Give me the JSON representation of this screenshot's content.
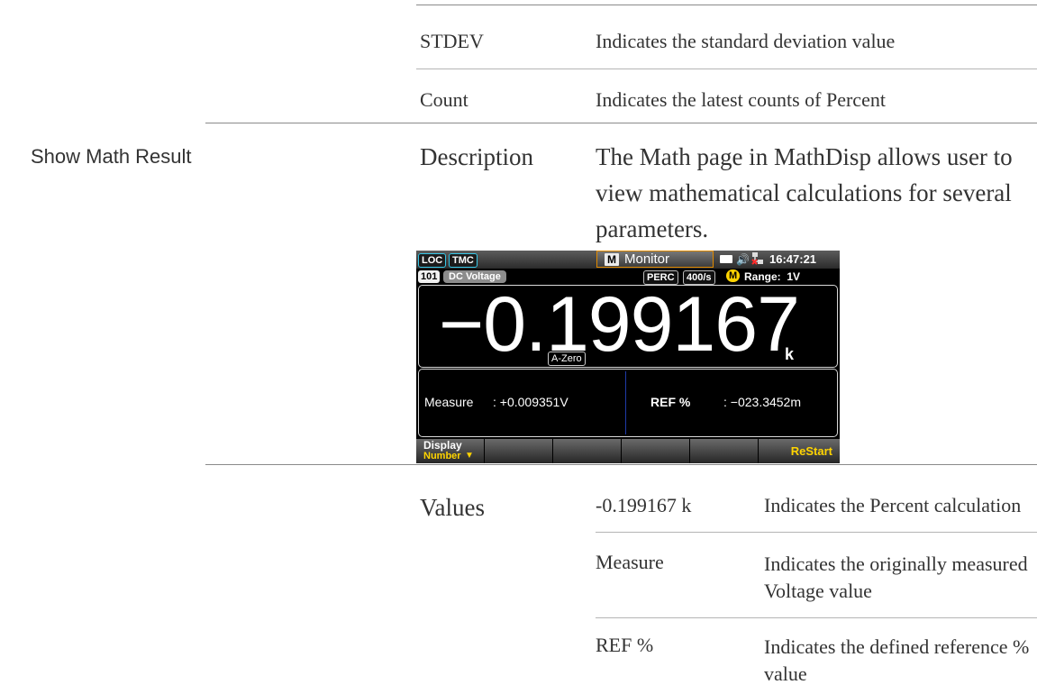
{
  "top_table": [
    {
      "term": "STDEV",
      "desc": "Indicates the standard deviation value"
    },
    {
      "term": "Count",
      "desc": "Indicates the latest counts of Percent"
    }
  ],
  "section": {
    "heading": "Show Math Result",
    "label": "Description",
    "text": "The Math page in MathDisp allows user to view mathematical calculations for several parameters."
  },
  "device": {
    "status": {
      "loc": "LOC",
      "tmc": "TMC",
      "m": "M",
      "monitor": "Monitor",
      "time": "16:47:21",
      "icons": [
        "card-icon",
        "speaker-icon",
        "network-disconnected-icon"
      ]
    },
    "info": {
      "channel": "101",
      "function": "DC Voltage",
      "math": "PERC",
      "rate": "400/s",
      "range_badge": "M",
      "range": "Range:  1V"
    },
    "reading": "−0.199167",
    "unit": "k",
    "azero": "A-Zero",
    "measure_label": "Measure",
    "measure_value": ": +0.009351V",
    "ref_label": "REF %",
    "ref_value": ": −023.3452m",
    "softkeys": {
      "display_top": "Display",
      "display_bottom": "Number",
      "restart": "ReStart"
    },
    "colors": {
      "accent": "#ffd400",
      "cyan": "#35c7e8",
      "orange": "#e08a00"
    }
  },
  "values": {
    "label": "Values",
    "rows": [
      {
        "term": "-0.199167 k",
        "desc": "Indicates the Percent calculation"
      },
      {
        "term": "Measure",
        "desc": "Indicates the originally measured Voltage value"
      },
      {
        "term": "REF %",
        "desc": "Indicates the defined reference % value"
      }
    ]
  }
}
